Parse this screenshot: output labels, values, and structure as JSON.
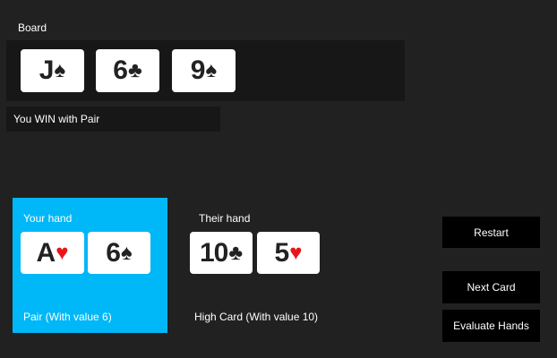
{
  "board": {
    "label": "Board",
    "cards": [
      {
        "rank": "J",
        "suit": "♠"
      },
      {
        "rank": "6",
        "suit": "♣"
      },
      {
        "rank": "9",
        "suit": "♠"
      }
    ]
  },
  "result": "You WIN with Pair",
  "your_hand": {
    "label": "Your hand",
    "cards": [
      {
        "rank": "A",
        "suit": "♥"
      },
      {
        "rank": "6",
        "suit": "♠"
      }
    ],
    "description": "Pair (With value 6)"
  },
  "their_hand": {
    "label": "Their hand",
    "cards": [
      {
        "rank": "10",
        "suit": "♣"
      },
      {
        "rank": "5",
        "suit": "♥"
      }
    ],
    "description": "High Card (With value 10)"
  },
  "buttons": {
    "restart": "Restart",
    "next_card": "Next Card",
    "evaluate": "Evaluate Hands"
  },
  "colors": {
    "background": "#212121",
    "panel": "#171717",
    "your_hand_highlight": "#00b7f7",
    "card_face": "#ffffff",
    "red_suit": "#e8161b"
  }
}
